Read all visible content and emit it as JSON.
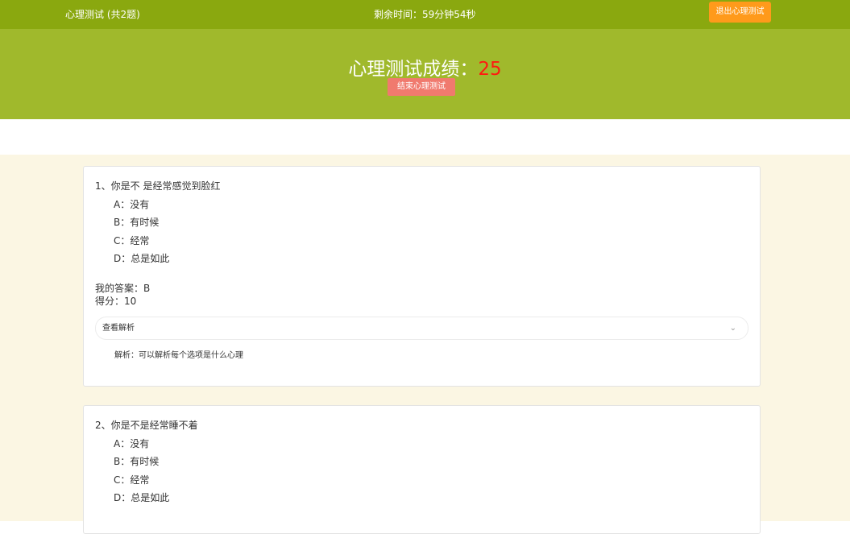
{
  "header": {
    "title": "心理测试 (共2题)",
    "timer": "剩余时间：59分钟54秒",
    "exit_label": "退出心理测试"
  },
  "hero": {
    "score_label": "心理测试成绩：",
    "score_value": "25",
    "end_label": "结束心理测试"
  },
  "questions": [
    {
      "title": "1、你是不 是经常感觉到脸红",
      "options": [
        "A：没有",
        "B：有时候",
        "C：经常",
        "D：总是如此"
      ],
      "my_answer": "我的答案：B",
      "score": "得分：10",
      "analysis_toggle": "查看解析",
      "analysis": "解析：可以解析每个选项是什么心理"
    },
    {
      "title": "2、你是不是经常睡不着",
      "options": [
        "A：没有",
        "B：有时候",
        "C：经常",
        "D：总是如此"
      ]
    }
  ],
  "colors": {
    "topbar": "#8aa80f",
    "hero": "#a0b92c",
    "exit_button": "#ff9a1b",
    "end_button": "#f07a6e",
    "score": "#ff1a10",
    "content_bg": "#fbf6e3"
  }
}
